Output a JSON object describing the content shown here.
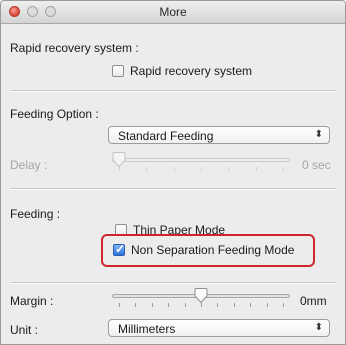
{
  "window": {
    "title": "More"
  },
  "rapid": {
    "section_label": "Rapid recovery system :",
    "checkbox_label": "Rapid recovery system",
    "checked": false
  },
  "feeding_option": {
    "section_label": "Feeding Option :",
    "selected": "Standard Feeding",
    "arrows": "⬍"
  },
  "delay": {
    "label": "Delay :",
    "value": "0 sec",
    "position": 0,
    "enabled": false
  },
  "feeding": {
    "section_label": "Feeding :",
    "thin_paper_label": "Thin Paper Mode",
    "thin_paper_checked": false,
    "non_separation_label": "Non Separation Feeding Mode",
    "non_separation_checked": true
  },
  "margin": {
    "label": "Margin :",
    "value": "0mm",
    "position": 0.5
  },
  "unit": {
    "label": "Unit :",
    "selected": "Millimeters",
    "arrows": "⬍"
  },
  "colors": {
    "highlight": "#d1232f",
    "checkbox_checked": "#2d74d8",
    "close_button": "#d9443a"
  },
  "icons": {
    "close": "close-icon",
    "minimize": "minimize-icon",
    "zoom": "zoom-icon",
    "popup_arrows": "updown-arrows-icon",
    "check": "checkmark-icon",
    "slider_thumb": "slider-thumb-icon"
  }
}
